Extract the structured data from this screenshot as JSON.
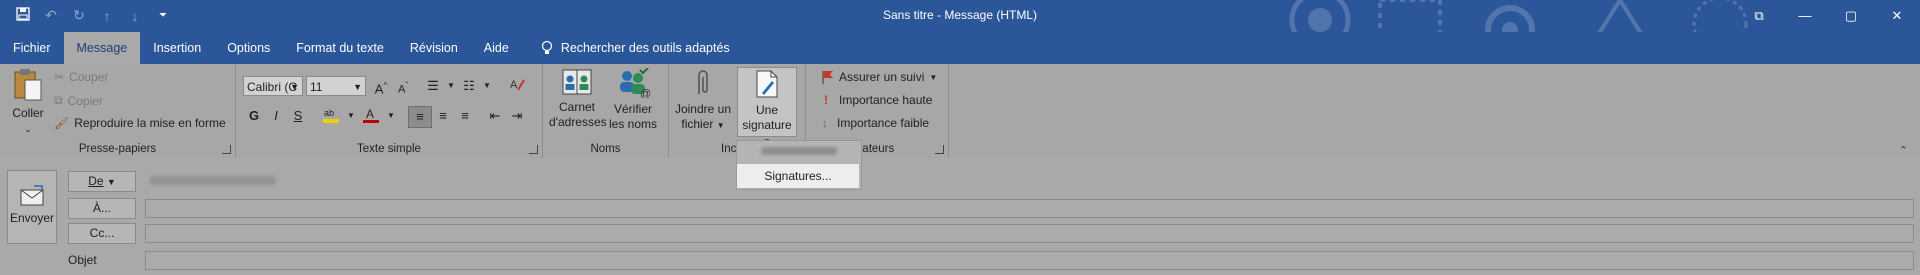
{
  "window": {
    "title": "Sans titre  -  Message (HTML)",
    "controls": [
      "⧉",
      "—",
      "▢",
      "✕"
    ]
  },
  "qat": {
    "save_icon": "save-icon",
    "undo_icon": "undo-icon",
    "redo_icon": "redo-icon",
    "up_icon": "arrow-up-icon",
    "down_icon": "arrow-down-icon",
    "customize_icon": "customize-qat-icon"
  },
  "tabs": [
    "Fichier",
    "Message",
    "Insertion",
    "Options",
    "Format du texte",
    "Révision",
    "Aide"
  ],
  "active_tab": "Message",
  "tellme": {
    "label": "Rechercher des outils adaptés",
    "icon": "lightbulb-icon"
  },
  "ribbon": {
    "clipboard": {
      "label": "Presse-papiers",
      "paste": "Coller",
      "cut": "Couper",
      "copy": "Copier",
      "format_painter": "Reproduire la mise en forme"
    },
    "basic_text": {
      "label": "Texte simple",
      "font": "Calibri (C",
      "size": "11",
      "bold": "G",
      "italic": "I",
      "underline": "S"
    },
    "names": {
      "label": "Noms",
      "address_book_1": "Carnet",
      "address_book_2": "d'adresses",
      "check_names_1": "Vérifier",
      "check_names_2": "les noms"
    },
    "include": {
      "label": "Inc",
      "attach_1": "Joindre un",
      "attach_2": "fichier",
      "signature_1": "Une",
      "signature_2": "signature"
    },
    "tags": {
      "label": "icateurs",
      "follow_up": "Assurer un suivi",
      "high": "Importance haute",
      "low": "Importance faible"
    }
  },
  "signature_menu": {
    "item": "Signatures..."
  },
  "form": {
    "send": "Envoyer",
    "from": "De",
    "to": "À...",
    "cc": "Cc...",
    "subject": "Objet"
  },
  "colors": {
    "title_bar": "#2b579a",
    "ribbon_bg": "#a7a7a7",
    "highlight_yellow": "#e8d200",
    "font_color_red": "#c00000",
    "flag_red": "#c0392b"
  }
}
